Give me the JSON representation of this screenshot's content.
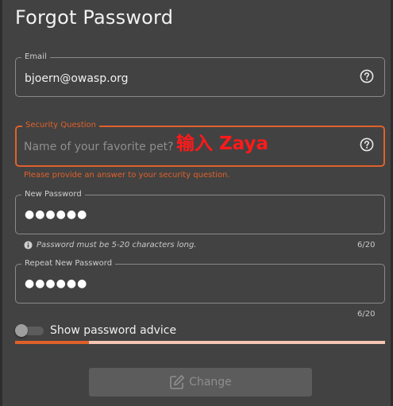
{
  "title": "Forgot Password",
  "email": {
    "label": "Email",
    "value": "bjoern@owasp.org"
  },
  "security_question": {
    "label": "Security Question",
    "placeholder": "Name of your favorite pet?",
    "error": "Please provide an answer to your security question."
  },
  "annotation": "输入 Zaya",
  "new_password": {
    "label": "New Password",
    "value": "●●●●●●",
    "hint": "Password must be 5-20 characters long.",
    "counter": "6/20"
  },
  "repeat_password": {
    "label": "Repeat New Password",
    "value": "●●●●●●",
    "counter": "6/20"
  },
  "toggle": {
    "label": "Show password advice",
    "on": false
  },
  "strength": {
    "fraction": 0.2
  },
  "button": {
    "label": "Change",
    "disabled": true
  },
  "colors": {
    "accent": "#e0602a",
    "background": "#424242",
    "annotation": "#ff1a1a"
  }
}
